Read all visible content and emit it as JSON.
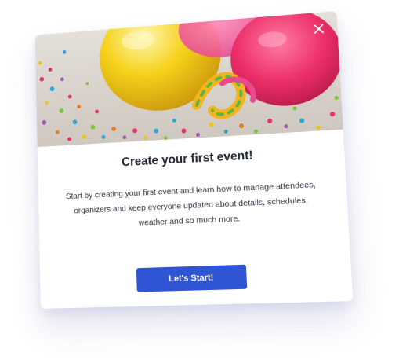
{
  "modal": {
    "title": "Create your first event!",
    "description": "Start by creating your first event and learn how to manage attendees, organizers and keep everyone updated about details, schedules, weather and so much more.",
    "cta_label": "Let's Start!",
    "close_icon": "close-icon",
    "hero_image": "party-balloons-confetti-image"
  },
  "colors": {
    "accent": "#2f55d4",
    "balloon_yellow": "#f1c40f",
    "balloon_pink": "#e8306c",
    "confetti_background": "#dcd6cf"
  }
}
